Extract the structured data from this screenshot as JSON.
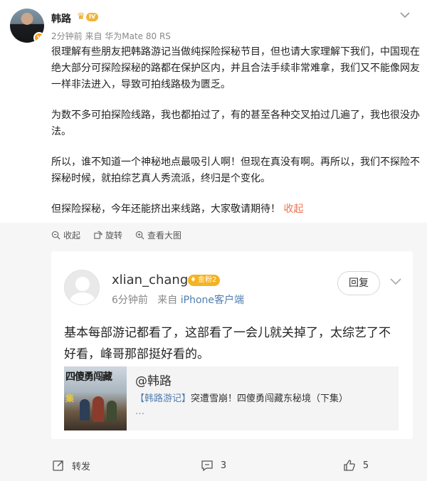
{
  "post": {
    "user_name": "韩路",
    "level": "IV",
    "meta": "2分钟前 来自 华为Mate 80 RS",
    "paragraphs": [
      "很理解有些朋友把韩路游记当做纯探险探秘节目，但也请大家理解下我们，中国现在绝大部分可探险探秘的路都在保护区内，并且合法手续非常难拿，我们又不能像网友一样非法进入，导致可拍线路极为匮乏。",
      "为数不多可拍探险线路，我也都拍过了，有的甚至各种交叉拍过几遍了，我也很没办法。",
      "所以，谁不知道一个神秘地点最吸引人啊！但现在真没有啊。再所以，我们不探险不探秘时候，就拍综艺真人秀流派，终归是个变化。"
    ],
    "last_paragraph": "但探险探秘，今年还能挤出来线路，大家敬请期待！",
    "collapse_label": "收起"
  },
  "actions": {
    "collect": "收起",
    "rotate": "旋转",
    "view_large": "查看大图"
  },
  "comment": {
    "user_name": "xlian_chang",
    "badge": "金粉2",
    "time": "6分钟前",
    "source_prefix": "来自",
    "source_app": "iPhone客户端",
    "reply_label": "回复",
    "text": "基本每部游记都看了，这部看了一会儿就关掉了，太综艺了不好看，峰哥那部挺好看的。",
    "share": {
      "thumb_text_1": "四傻勇闯藏",
      "thumb_text_2": "集",
      "at_user": "@韩路",
      "title_tag": "【韩路游记】",
      "title_rest": "突遭雪崩！四傻勇闯藏东秘境（下集）",
      "more": "…"
    }
  },
  "footer": {
    "repost_label": "转发",
    "comment_count": "3",
    "like_count": "5"
  },
  "colors": {
    "accent_orange": "#eb7350",
    "link_blue": "#507daf",
    "badge_gold": "#f5b223"
  }
}
